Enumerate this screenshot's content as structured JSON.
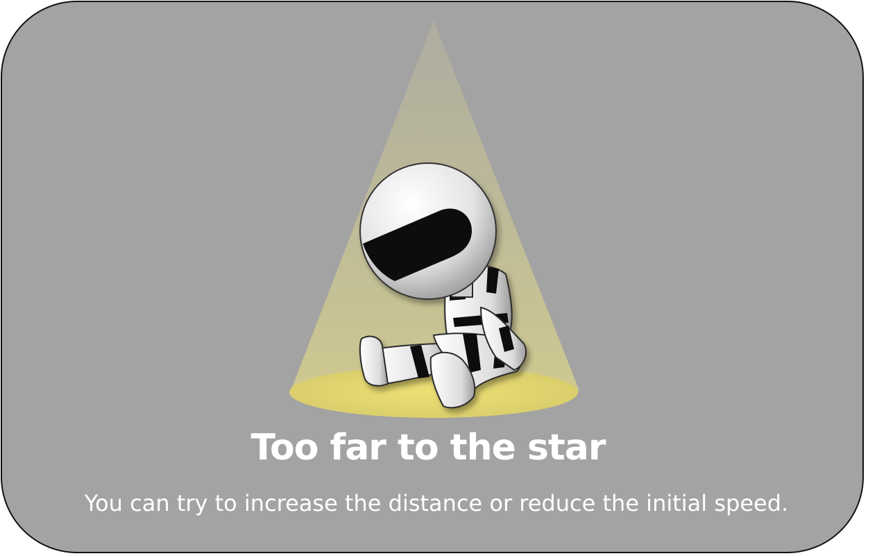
{
  "dialog": {
    "title": "Too far to the star",
    "message": "You can try to increase the distance or reduce the initial speed.",
    "colors": {
      "background": "#a3a3a3",
      "border": "#111111",
      "spotlight_beam": "#cfc994",
      "spotlight_floor": "#e3d778",
      "text": "#ffffff"
    }
  },
  "illustration": {
    "subject": "robot-sitting-in-spotlight",
    "icons": [
      "spotlight-beam",
      "spotlight-floor",
      "robot"
    ]
  }
}
